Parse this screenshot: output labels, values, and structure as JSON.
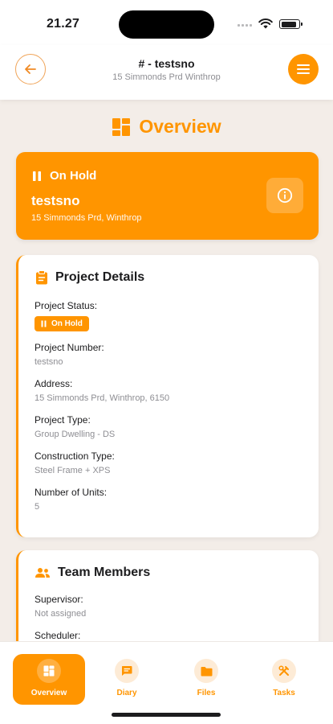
{
  "status_bar": {
    "time": "21.27"
  },
  "header": {
    "title": "# - testsno",
    "subtitle": "15 Simmonds Prd Winthrop"
  },
  "page": {
    "title": "Overview"
  },
  "status_card": {
    "state": "On Hold",
    "project_name": "testsno",
    "address": "15 Simmonds Prd, Winthrop"
  },
  "project_details": {
    "title": "Project Details",
    "status_label": "Project Status:",
    "status_badge": "On Hold",
    "number_label": "Project Number:",
    "number_value": "testsno",
    "address_label": "Address:",
    "address_value": "15 Simmonds Prd, Winthrop, 6150",
    "type_label": "Project Type:",
    "type_value": "Group Dwelling - DS",
    "construction_label": "Construction Type:",
    "construction_value": "Steel Frame + XPS",
    "units_label": "Number of Units:",
    "units_value": "5"
  },
  "team_members": {
    "title": "Team Members",
    "supervisor_label": "Supervisor:",
    "supervisor_value": "Not assigned",
    "scheduler_label": "Scheduler:"
  },
  "tabs": [
    {
      "label": "Overview",
      "icon": "dashboard-icon",
      "active": true
    },
    {
      "label": "Diary",
      "icon": "chat-icon",
      "active": false
    },
    {
      "label": "Files",
      "icon": "folder-icon",
      "active": false
    },
    {
      "label": "Tasks",
      "icon": "tools-icon",
      "active": false
    }
  ],
  "colors": {
    "accent": "#ff9500",
    "background": "#f3ede8",
    "card": "#ffffff",
    "muted_text": "#8e8e93"
  }
}
